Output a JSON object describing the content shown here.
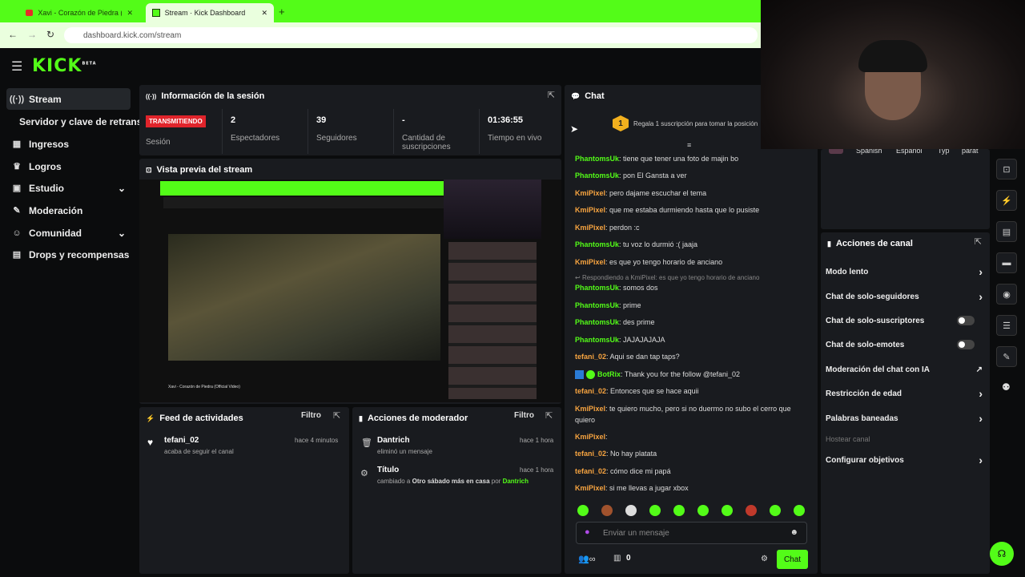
{
  "browser": {
    "tab1_title": "Xavi - Corazón de Piedra (C",
    "tab2_title": "Stream · Kick Dashboard",
    "url": "dashboard.kick.com/stream"
  },
  "brand": {
    "logo": "KICK",
    "beta": "BETA"
  },
  "sidebar": {
    "items": [
      {
        "label": "Stream",
        "icon": "broadcast-icon"
      },
      {
        "label": "Servidor y clave de retransm"
      },
      {
        "label": "Ingresos",
        "icon": "chart-icon"
      },
      {
        "label": "Logros",
        "icon": "trophy-icon"
      },
      {
        "label": "Estudio",
        "icon": "studio-icon"
      },
      {
        "label": "Moderación",
        "icon": "wrench-icon"
      },
      {
        "label": "Comunidad",
        "icon": "people-icon"
      },
      {
        "label": "Drops y recompensas",
        "icon": "gift-icon"
      }
    ]
  },
  "session": {
    "title": "Información de la sesión",
    "live_badge": "TRANSMITIENDO",
    "session_label": "Sesión",
    "viewers_value": "2",
    "viewers_label": "Espectadores",
    "followers_value": "39",
    "followers_label": "Seguidores",
    "subs_value": "-",
    "subs_label": "Cantidad de suscripciones",
    "time_value": "01:36:55",
    "time_label": "Tiempo en vivo"
  },
  "preview": {
    "title": "Vista previa del stream",
    "video_caption": "Xavi - Corazón de Piedra (Official Video)"
  },
  "activity": {
    "title": "Feed de actividades",
    "filter": "Filtro",
    "user": "tefani_02",
    "time": "hace 4 minutos",
    "text": "acaba de seguir el canal"
  },
  "modactions": {
    "title": "Acciones de moderador",
    "filter": "Filtro",
    "a1_user": "Dantrich",
    "a1_time": "hace 1 hora",
    "a1_text": "eliminó un mensaje",
    "a2_user": "Título",
    "a2_time": "hace 1 hora",
    "a2_pre": "cambiado a",
    "a2_value": "Otro sábado más en casa",
    "a2_mid": "por",
    "a2_by": "Dantrich"
  },
  "chat": {
    "title": "Chat",
    "banner": "Regala 1 suscripción para tomar la posición",
    "banner_rank": "1",
    "reply_note": "Respondiendo a KmiPixel: es que yo tengo horario de anciano",
    "messages": [
      {
        "user": "PhantomsUk",
        "text": ": tiene que tener una foto de majin bo",
        "color": "#53fc18"
      },
      {
        "user": "PhantomsUk",
        "text": ": pon El Gansta a ver",
        "color": "#53fc18"
      },
      {
        "user": "KmiPixel",
        "text": ": pero dajame escuchar el tema",
        "color": "#f7a440"
      },
      {
        "user": "KmiPixel",
        "text": ": que me estaba durmiendo hasta que lo pusiste",
        "color": "#f7a440"
      },
      {
        "user": "KmiPixel",
        "text": ": perdon :c",
        "color": "#f7a440"
      },
      {
        "user": "PhantomsUk",
        "text": ": tu voz lo durmió :( jaaja",
        "color": "#53fc18"
      },
      {
        "user": "KmiPixel",
        "text": ": es que yo tengo horario de anciano",
        "color": "#f7a440"
      },
      {
        "user": "PhantomsUk",
        "text": ": somos dos",
        "color": "#53fc18"
      },
      {
        "user": "PhantomsUk",
        "text": ": prime",
        "color": "#53fc18"
      },
      {
        "user": "PhantomsUk",
        "text": ": des prime",
        "color": "#53fc18"
      },
      {
        "user": "PhantomsUk",
        "text": ": JAJAJAJAJA",
        "color": "#53fc18"
      },
      {
        "user": "tefani_02",
        "text": ": Aqui se dan tap taps?",
        "color": "#f7a440"
      },
      {
        "user": "BotRix",
        "text": ": Thank you for the follow @tefani_02",
        "color": "#53fc18"
      },
      {
        "user": "tefani_02",
        "text": ": Entonces que se hace aquii",
        "color": "#f7a440"
      },
      {
        "user": "KmiPixel",
        "text": ": te quiero mucho, pero si no duermo no subo el cerro que quiero",
        "color": "#f7a440"
      },
      {
        "user": "KmiPixel",
        "text": ":",
        "color": "#f7a440"
      },
      {
        "user": "tefani_02",
        "text": ": No hay platata",
        "color": "#f7a440"
      },
      {
        "user": "tefani_02",
        "text": ": cómo dice mi papá",
        "color": "#f7a440"
      },
      {
        "user": "KmiPixel",
        "text": ": si me llevas a jugar xbox",
        "color": "#f7a440"
      }
    ],
    "input_placeholder": "Enviar un mensaje",
    "viewers_count": "0",
    "send_label": "Chat"
  },
  "tags": [
    "Spanish",
    "Español",
    "Typ",
    "parat"
  ],
  "channel_actions": {
    "title": "Acciones de canal",
    "items": [
      {
        "label": "Modo lento",
        "control": "chevron"
      },
      {
        "label": "Chat de solo-seguidores",
        "control": "chevron"
      },
      {
        "label": "Chat de solo-suscriptores",
        "control": "toggle"
      },
      {
        "label": "Chat de solo-emotes",
        "control": "toggle"
      },
      {
        "label": "Moderación del chat con IA",
        "control": "external"
      },
      {
        "label": "Restricción de edad",
        "control": "chevron"
      },
      {
        "label": "Palabras baneadas",
        "control": "chevron"
      },
      {
        "label": "Hostear canal",
        "control": "disabled"
      },
      {
        "label": "Configurar objetivos",
        "control": "chevron"
      }
    ]
  }
}
